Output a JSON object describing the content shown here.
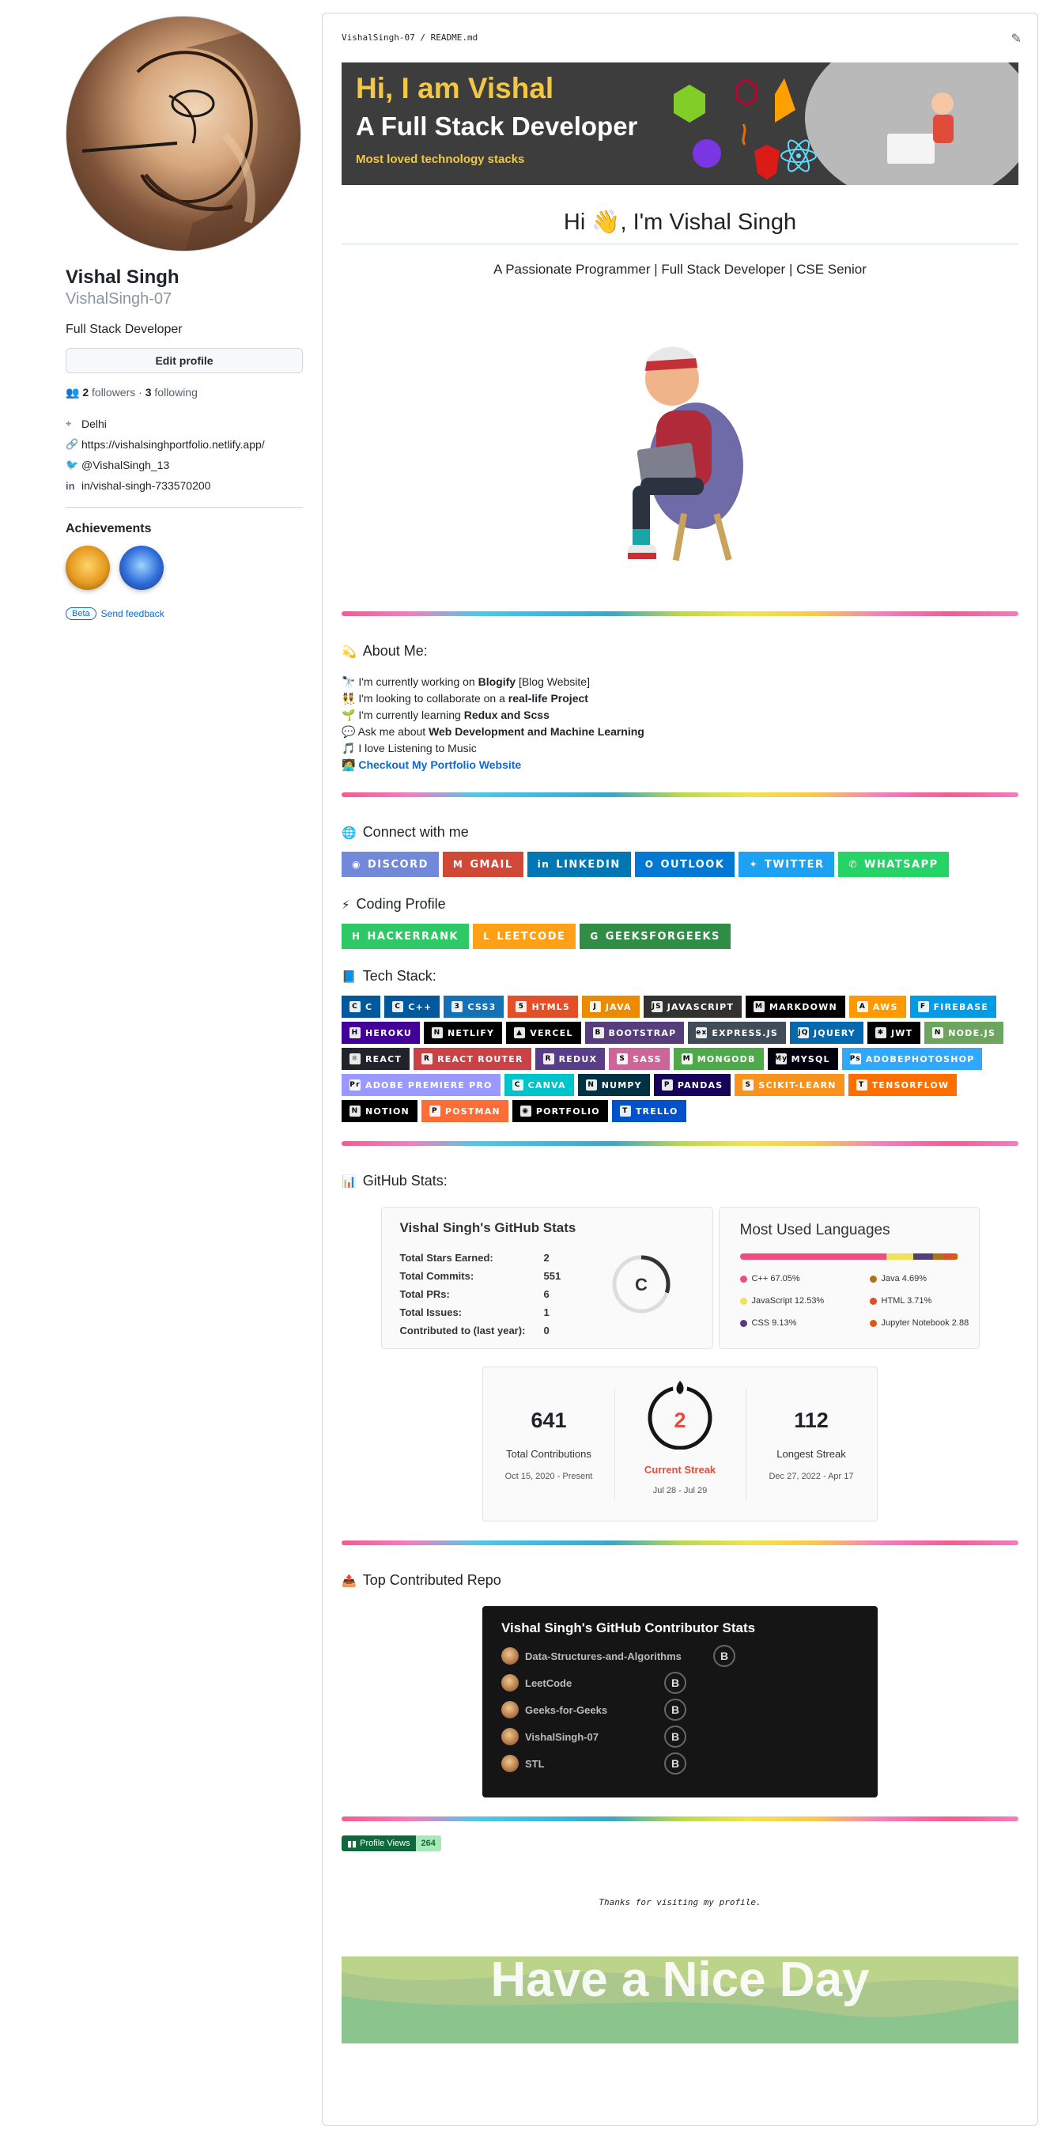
{
  "profile": {
    "name": "Vishal Singh",
    "login": "VishalSingh-07",
    "bio": "Full Stack Developer",
    "edit_label": "Edit profile",
    "followers_count": "2",
    "followers_label": "followers",
    "following_count": "3",
    "following_label": "following",
    "separator": "·",
    "location": "Delhi",
    "website": "https://vishalsinghportfolio.netlify.app/",
    "twitter": "@VishalSingh_13",
    "linkedin": "in/vishal-singh-733570200",
    "achievements_title": "Achievements",
    "beta_label": "Beta",
    "feedback_label": "Send feedback"
  },
  "readme": {
    "path": "VishalSingh-07 / README.md",
    "banner": {
      "line1_prefix": "Hi, I am ",
      "line1_name": "Vishal",
      "line2": "A Full Stack Developer",
      "line3": "Most loved technology stacks"
    },
    "heading": "Hi 👋, I'm Vishal Singh",
    "tagline": "A Passionate Programmer | Full Stack Developer | CSE Senior",
    "about_title": "About Me:",
    "about": [
      {
        "icon": "🔭",
        "pre": "I'm currently working on ",
        "bold": "Blogify",
        "post": " [Blog Website]"
      },
      {
        "icon": "👯",
        "pre": "I'm looking to collaborate on a ",
        "bold": "real-life Project",
        "post": ""
      },
      {
        "icon": "🌱",
        "pre": "I'm currently learning ",
        "bold": "Redux and Scss",
        "post": ""
      },
      {
        "icon": "💬",
        "pre": "Ask me about ",
        "bold": "Web Development and Machine Learning",
        "post": ""
      },
      {
        "icon": "🎵",
        "pre": "I love Listening to Music",
        "bold": "",
        "post": ""
      }
    ],
    "portfolio_icon": "🧑‍💻",
    "portfolio_link": "Checkout My Portfolio Website",
    "connect_title": "Connect with me",
    "connect": [
      {
        "label": "DISCORD",
        "color": "#7289DA",
        "icon": "◉"
      },
      {
        "label": "GMAIL",
        "color": "#D14836",
        "icon": "M"
      },
      {
        "label": "LINKEDIN",
        "color": "#0077B5",
        "icon": "in"
      },
      {
        "label": "OUTLOOK",
        "color": "#0078D4",
        "icon": "O"
      },
      {
        "label": "TWITTER",
        "color": "#1DA1F2",
        "icon": "✦"
      },
      {
        "label": "WHATSAPP",
        "color": "#25D366",
        "icon": "✆"
      }
    ],
    "coding_title": "Coding Profile",
    "coding": [
      {
        "label": "HACKERRANK",
        "color": "#2EC866",
        "icon": "H"
      },
      {
        "label": "LEETCODE",
        "color": "#FFA116",
        "icon": "L"
      },
      {
        "label": "GEEKSFORGEEKS",
        "color": "#2F8D46",
        "icon": "G"
      }
    ],
    "tech_title": "Tech Stack:",
    "tech": [
      {
        "label": "C",
        "color": "#00599C",
        "icon": "C"
      },
      {
        "label": "C++",
        "color": "#00599C",
        "icon": "C"
      },
      {
        "label": "CSS3",
        "color": "#1572B6",
        "icon": "3"
      },
      {
        "label": "HTML5",
        "color": "#E34F26",
        "icon": "5"
      },
      {
        "label": "JAVA",
        "color": "#ED8B00",
        "icon": "J"
      },
      {
        "label": "JAVASCRIPT",
        "color": "#323330",
        "icon": "JS"
      },
      {
        "label": "MARKDOWN",
        "color": "#000000",
        "icon": "M"
      },
      {
        "label": "AWS",
        "color": "#FF9900",
        "icon": "A"
      },
      {
        "label": "FIREBASE",
        "color": "#039BE5",
        "icon": "F"
      },
      {
        "label": "HEROKU",
        "color": "#430098",
        "icon": "H"
      },
      {
        "label": "NETLIFY",
        "color": "#000000",
        "icon": "N"
      },
      {
        "label": "VERCEL",
        "color": "#000000",
        "icon": "▲"
      },
      {
        "label": "BOOTSTRAP",
        "color": "#563D7C",
        "icon": "B"
      },
      {
        "label": "EXPRESS.JS",
        "color": "#404D59",
        "icon": "ex"
      },
      {
        "label": "JQUERY",
        "color": "#0769AD",
        "icon": "jQ"
      },
      {
        "label": "JWT",
        "color": "#000000",
        "icon": "✱"
      },
      {
        "label": "NODE.JS",
        "color": "#6DA55F",
        "icon": "N"
      },
      {
        "label": "REACT",
        "color": "#20232A",
        "icon": "⚛"
      },
      {
        "label": "REACT ROUTER",
        "color": "#CA4245",
        "icon": "R"
      },
      {
        "label": "REDUX",
        "color": "#593D88",
        "icon": "R"
      },
      {
        "label": "SASS",
        "color": "#CC6699",
        "icon": "S"
      },
      {
        "label": "MONGODB",
        "color": "#4EA94B",
        "icon": "M"
      },
      {
        "label": "MYSQL",
        "color": "#00000F",
        "icon": "My"
      },
      {
        "label": "ADOBEPHOTOSHOP",
        "color": "#31A8FF",
        "icon": "Ps"
      },
      {
        "label": "ADOBE PREMIERE PRO",
        "color": "#9999FF",
        "icon": "Pr"
      },
      {
        "label": "CANVA",
        "color": "#00C4CC",
        "icon": "C"
      },
      {
        "label": "NUMPY",
        "color": "#013243",
        "icon": "N"
      },
      {
        "label": "PANDAS",
        "color": "#150458",
        "icon": "P"
      },
      {
        "label": "SCIKIT-LEARN",
        "color": "#F7931E",
        "icon": "S"
      },
      {
        "label": "TENSORFLOW",
        "color": "#FF6F00",
        "icon": "T"
      },
      {
        "label": "NOTION",
        "color": "#000000",
        "icon": "N"
      },
      {
        "label": "POSTMAN",
        "color": "#FF6C37",
        "icon": "P"
      },
      {
        "label": "PORTFOLIO",
        "color": "#000000",
        "icon": "◉"
      },
      {
        "label": "TRELLO",
        "color": "#0052CC",
        "icon": "T"
      }
    ],
    "stats_title": "GitHub Stats:",
    "stats_card": {
      "title": "Vishal Singh's GitHub Stats",
      "rows": [
        {
          "label": "Total Stars Earned:",
          "value": "2"
        },
        {
          "label": "Total Commits:",
          "value": "551"
        },
        {
          "label": "Total PRs:",
          "value": "6"
        },
        {
          "label": "Total Issues:",
          "value": "1"
        },
        {
          "label": "Contributed to (last year):",
          "value": "0"
        }
      ],
      "rank": "C",
      "rank_progress": 0.3
    },
    "langs_card": {
      "title": "Most Used Languages",
      "langs": [
        {
          "name": "C++ 67.05%",
          "pct": 67.05,
          "color": "#f34b7d"
        },
        {
          "name": "Java 4.69%",
          "pct": 4.69,
          "color": "#b07219"
        },
        {
          "name": "JavaScript 12.53%",
          "pct": 12.53,
          "color": "#f1e05a"
        },
        {
          "name": "HTML 3.71%",
          "pct": 3.71,
          "color": "#e34c26"
        },
        {
          "name": "CSS 9.13%",
          "pct": 9.13,
          "color": "#563d7c"
        },
        {
          "name": "Jupyter Notebook 2.88",
          "pct": 2.88,
          "color": "#DA5B0B"
        }
      ]
    },
    "streak": {
      "total": "641",
      "total_label": "Total Contributions",
      "total_range": "Oct 15, 2020 - Present",
      "current": "2",
      "current_label": "Current Streak",
      "current_range": "Jul 28 - Jul 29",
      "longest": "112",
      "longest_label": "Longest Streak",
      "longest_range": "Dec 27, 2022 - Apr 17",
      "accent": "#e74c3c"
    },
    "top_repo_title": "Top Contributed Repo",
    "contrib_card": {
      "title": "Vishal Singh's GitHub Contributor Stats",
      "repos": [
        {
          "name": "Data-Structures-and-Algorithms",
          "rank": "B"
        },
        {
          "name": "LeetCode",
          "rank": "B"
        },
        {
          "name": "Geeks-for-Geeks",
          "rank": "B"
        },
        {
          "name": "VishalSingh-07",
          "rank": "B"
        },
        {
          "name": "STL",
          "rank": "B"
        }
      ]
    },
    "views_label": "Profile Views",
    "views_count": "264",
    "thanks": "Thanks for visiting my profile.",
    "nice_day": "Have a Nice Day"
  }
}
